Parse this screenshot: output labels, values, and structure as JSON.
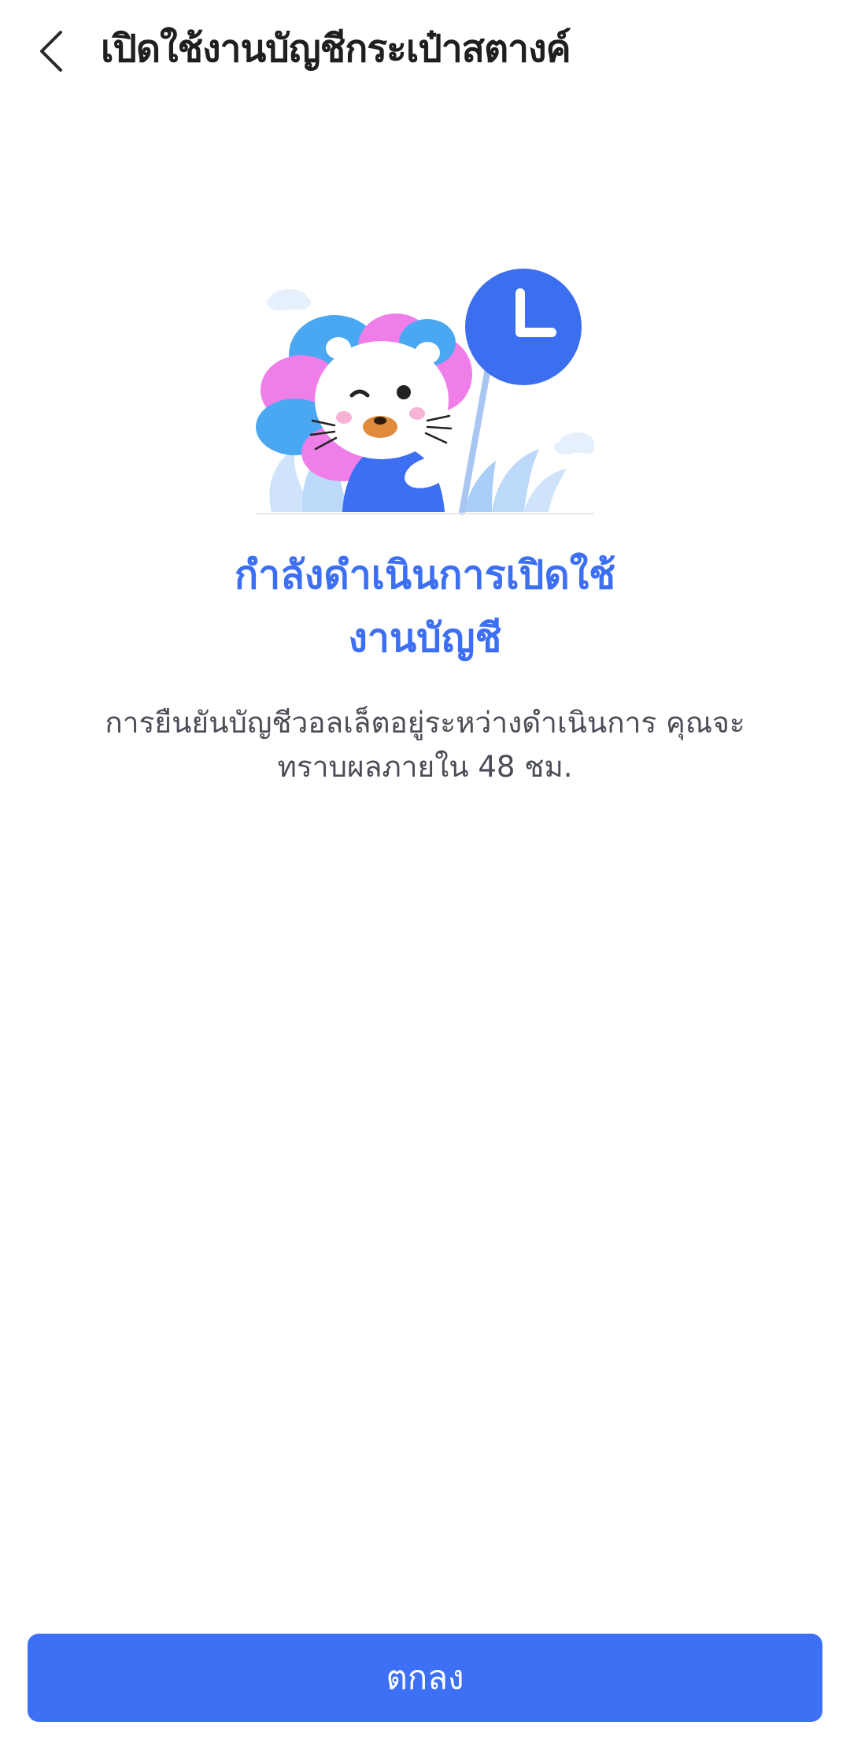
{
  "header": {
    "back_icon": "chevron-left-icon",
    "title": "เปิดใช้งานบัญชีกระเป๋าสตางค์"
  },
  "illustration": {
    "description_icon": "cat-mascot-clock-illustration",
    "colors": {
      "clock": "#3b6ff0",
      "petal_blue": "#4aa8f3",
      "petal_pink": "#f07ee8",
      "leaves": "#b9dafa",
      "body": "#3d6ff2"
    }
  },
  "status": {
    "title_line1": "กำลังดำเนินการเปิดใช้",
    "title_line2": "งานบัญชี",
    "description_line1": "การยืนยันบัญชีวอลเล็ตอยู่ระหว่างดำเนินการ คุณจะ",
    "description_line2": "ทราบผลภายใน 48 ชม."
  },
  "footer": {
    "ok_label": "ตกลง"
  },
  "colors": {
    "accent": "#3d70f5",
    "title_text": "#3d6ff2",
    "body_text": "#4a4d55"
  }
}
